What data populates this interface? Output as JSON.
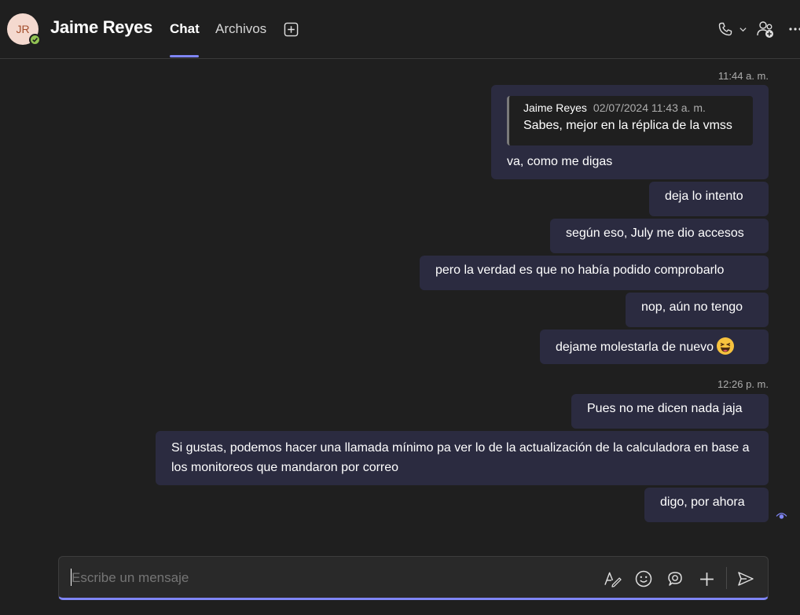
{
  "header": {
    "avatar_initials": "JR",
    "contact_name": "Jaime Reyes",
    "tabs": [
      {
        "label": "Chat",
        "active": true
      },
      {
        "label": "Archivos",
        "active": false
      }
    ],
    "add_tab_icon": "plus-square-icon",
    "call_icon": "phone-icon",
    "people_icon": "add-people-icon",
    "more_icon": "more-icon"
  },
  "messages": {
    "timestamp_1": "11:44 a. m.",
    "quoted": {
      "author": "Jaime Reyes",
      "date": "02/07/2024 11:43 a. m.",
      "text": "Sabes, mejor en la réplica de la vmss"
    },
    "m1": "va, como me digas",
    "m2": "deja lo intento",
    "m3": "según eso, July me dio accesos",
    "m4": "pero la verdad es que no había podido comprobarlo",
    "m5": "nop, aún no tengo",
    "m6": "dejame molestarla de nuevo",
    "timestamp_2": "12:26 p. m.",
    "m7": "Pues no me dicen nada jaja",
    "m8": "Si gustas, podemos hacer una llamada mínimo pa ver lo de la actualización de la calculadora en base a los monitoreos que mandaron por correo",
    "m9": "digo, por ahora",
    "read_receipt_icon": "eye-icon"
  },
  "composer": {
    "placeholder": "Escribe un mensaje",
    "icons": [
      "format-icon",
      "emoji-icon",
      "loop-icon",
      "plus-icon",
      "send-icon"
    ]
  },
  "colors": {
    "accent": "#7f85f5",
    "bubble": "#2b2b40",
    "background": "#1f1f1f",
    "presence": "#92c353"
  }
}
